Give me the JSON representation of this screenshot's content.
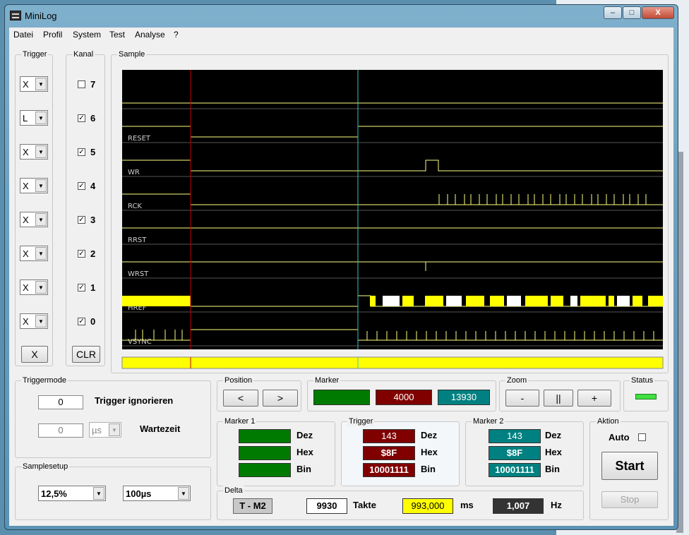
{
  "window": {
    "title": "MiniLog"
  },
  "title_buttons": {
    "minimize": "–",
    "maximize": "□",
    "close": "X"
  },
  "menu": [
    "Datei",
    "Profil",
    "System",
    "Test",
    "Analyse",
    "?"
  ],
  "trigger": {
    "legend": "Trigger",
    "rows": [
      "X",
      "L",
      "X",
      "X",
      "X",
      "X",
      "X",
      "X"
    ],
    "button": "X"
  },
  "kanal": {
    "legend": "Kanal",
    "channels": [
      {
        "num": "7",
        "checked": false
      },
      {
        "num": "6",
        "checked": true
      },
      {
        "num": "5",
        "checked": true
      },
      {
        "num": "4",
        "checked": true
      },
      {
        "num": "3",
        "checked": true
      },
      {
        "num": "2",
        "checked": true
      },
      {
        "num": "1",
        "checked": true
      },
      {
        "num": "0",
        "checked": true
      }
    ],
    "button": "CLR"
  },
  "sample": {
    "legend": "Sample",
    "signals": [
      "",
      "RESET",
      "WR",
      "RCK",
      "RRST",
      "WRST",
      "HREF",
      "VSYNC"
    ]
  },
  "triggermode": {
    "legend": "Triggermode",
    "value1": "0",
    "label1": "Trigger ignorieren",
    "value2": "0",
    "unit": "µs",
    "label2": "Wartezeit"
  },
  "samplesetup": {
    "legend": "Samplesetup",
    "rate": "12,5%",
    "time": "100µs"
  },
  "position": {
    "legend": "Position",
    "left": "<",
    "right": ">"
  },
  "marker": {
    "legend": "Marker",
    "m1": "",
    "trig": "4000",
    "m2": "13930"
  },
  "zoom": {
    "legend": "Zoom",
    "minus": "-",
    "pause": "||",
    "plus": "+"
  },
  "status": {
    "legend": "Status"
  },
  "marker1": {
    "legend": "Marker 1",
    "dez": "",
    "hex": "",
    "bin": "",
    "dez_label": "Dez",
    "hex_label": "Hex",
    "bin_label": "Bin"
  },
  "trigger_panel": {
    "legend": "Trigger",
    "dez": "143",
    "hex": "$8F",
    "bin": "10001111",
    "dez_label": "Dez",
    "hex_label": "Hex",
    "bin_label": "Bin"
  },
  "marker2": {
    "legend": "Marker 2",
    "dez": "143",
    "hex": "$8F",
    "bin": "10001111",
    "dez_label": "Dez",
    "hex_label": "Hex",
    "bin_label": "Bin"
  },
  "aktion": {
    "legend": "Aktion",
    "auto": "Auto",
    "start": "Start",
    "stop": "Stop"
  },
  "delta": {
    "legend": "Delta",
    "mode": "T - M2",
    "takte": "9930",
    "takte_label": "Takte",
    "ms": "993,000",
    "ms_label": "ms",
    "hz": "1,007",
    "hz_label": "Hz"
  },
  "colors": {
    "trace": "#ffff80",
    "bus": "#ffff00",
    "cursor_trigger": "#c00000",
    "cursor_marker": "#40c0c0",
    "status_led": "#40e040"
  }
}
